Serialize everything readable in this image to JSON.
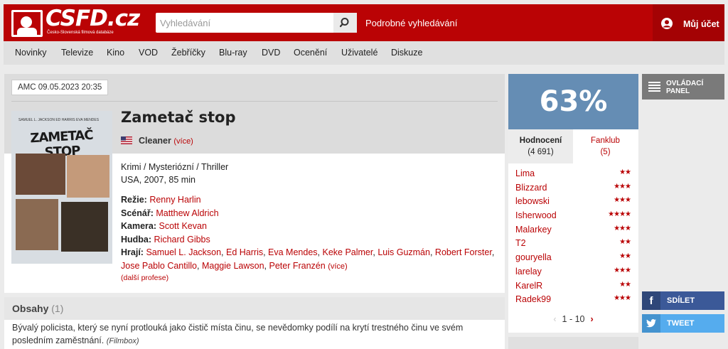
{
  "header": {
    "logo_text": "CSFD.cz",
    "logo_tagline": "Česko-Slovenská filmová databáze",
    "search_placeholder": "Vyhledávání",
    "advanced_search": "Podrobné vyhledávání",
    "account": "Můj účet"
  },
  "nav": {
    "items": [
      "Novinky",
      "Televize",
      "Kino",
      "VOD",
      "Žebříčky",
      "Blu-ray",
      "DVD",
      "Ocenění",
      "Uživatelé",
      "Diskuze"
    ]
  },
  "film": {
    "tv_badge": "AMC 09.05.2023 20:35",
    "title": "Zametač stop",
    "poster_title": "ZAMETAČ STOP",
    "poster_names": "SAMUEL L. JACKSON   ED HARRIS   EVA MENDES",
    "original_title": "Cleaner",
    "original_more": "(více)",
    "genres": "Krimi / Mysteriózní / Thriller",
    "origin": "USA, 2007, 85 min",
    "directing_label": "Režie:",
    "directing": "Renny Harlin",
    "screenplay_label": "Scénář:",
    "screenplay": "Matthew Aldrich",
    "camera_label": "Kamera:",
    "camera": "Scott Kevan",
    "music_label": "Hudba:",
    "music": "Richard Gibbs",
    "cast_label": "Hrají:",
    "cast": [
      "Samuel L. Jackson",
      "Ed Harris",
      "Eva Mendes",
      "Keke Palmer",
      "Luis Guzmán",
      "Robert Forster",
      "Jose Pablo Cantillo",
      "Maggie Lawson",
      "Peter Franzén"
    ],
    "cast_more": "(více)",
    "more_professions": "(další profese)"
  },
  "plot": {
    "heading": "Obsahy",
    "count": "(1)",
    "text": "Bývalý policista, který se nyní protlouká jako čistič místa činu, se nevědomky podílí na krytí trestného činu ve svém posledním zaměstnání.",
    "source": "(Filmbox)"
  },
  "rating": {
    "percent": "63%",
    "tab_ratings": "Hodnocení",
    "tab_ratings_count": "(4 691)",
    "tab_fanclub": "Fanklub",
    "tab_fanclub_count": "(5)",
    "users": [
      {
        "name": "Lima",
        "stars": "★★"
      },
      {
        "name": "Blizzard",
        "stars": "★★★"
      },
      {
        "name": "lebowski",
        "stars": "★★★"
      },
      {
        "name": "Isherwood",
        "stars": "★★★★"
      },
      {
        "name": "Malarkey",
        "stars": "★★★"
      },
      {
        "name": "T2",
        "stars": "★★"
      },
      {
        "name": "gouryella",
        "stars": "★★"
      },
      {
        "name": "larelay",
        "stars": "★★★"
      },
      {
        "name": "KarelR",
        "stars": "★★"
      },
      {
        "name": "Radek99",
        "stars": "★★★"
      }
    ],
    "pager": "1 - 10",
    "colors": {
      "percent_bg": "#658db4",
      "accent": "#ba0305"
    }
  },
  "sidebar": {
    "panel_label_1": "OVLÁDACÍ",
    "panel_label_2": "PANEL",
    "share": "SDÍLET",
    "tweet": "TWEET"
  }
}
